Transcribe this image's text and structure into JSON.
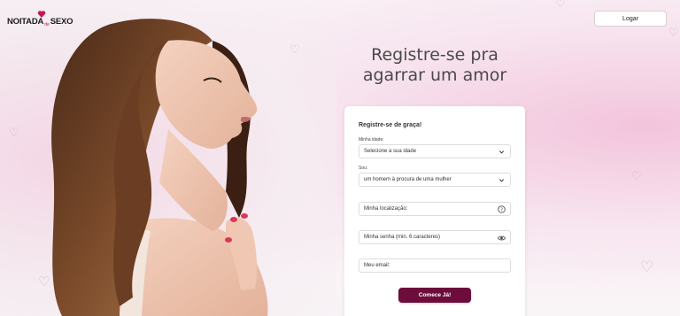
{
  "logo": {
    "left": "NOITADA",
    "middle": "de",
    "right": "SEXO"
  },
  "header": {
    "login_label": "Logar"
  },
  "hero": {
    "headline_line1": "Registre-se pra",
    "headline_line2": "agarrar um amor"
  },
  "form": {
    "title": "Registre-se de graça!",
    "age": {
      "label": "Minha idade:",
      "value": "Selecione a sua idade"
    },
    "gender": {
      "label": "Sou:",
      "value": "um homem à procura de uma mulher"
    },
    "location": {
      "placeholder": "Minha localização:"
    },
    "password": {
      "placeholder": "Minha senha (min. 6 caracteres)"
    },
    "email": {
      "placeholder": "Meu email:"
    },
    "submit_label": "Comece Já!"
  },
  "colors": {
    "brand": "#6d0d3b",
    "accent": "#b3194f"
  },
  "icons": [
    "heart-logo-icon",
    "chevron-down-icon",
    "help-icon",
    "eye-icon",
    "heart-outline-icon"
  ]
}
